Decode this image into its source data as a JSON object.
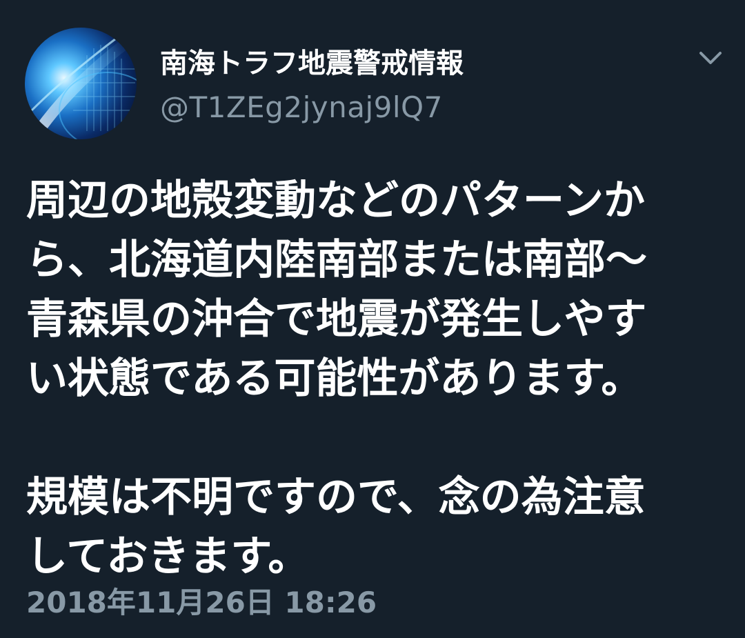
{
  "account": {
    "display_name": "南海トラフ地震警戒情報",
    "handle": "@T1ZEg2jynaj9lQ7",
    "avatar_icon": "globe-digital-avatar"
  },
  "menu": {
    "icon": "chevron-down-icon"
  },
  "tweet": {
    "paragraph_1": "周辺の地殻変動などのパターンか\nら、北海道内陸南部または南部〜\n青森県の沖合で地震が発生しやす\nい状態である可能性があります。",
    "paragraph_2": "規模は不明ですので、念の為注意\nしておきます。",
    "timestamp": "2018年11月26日 18:26"
  },
  "colors": {
    "background": "#15202b",
    "primary_text": "#ffffff",
    "secondary_text": "#8899a6"
  }
}
